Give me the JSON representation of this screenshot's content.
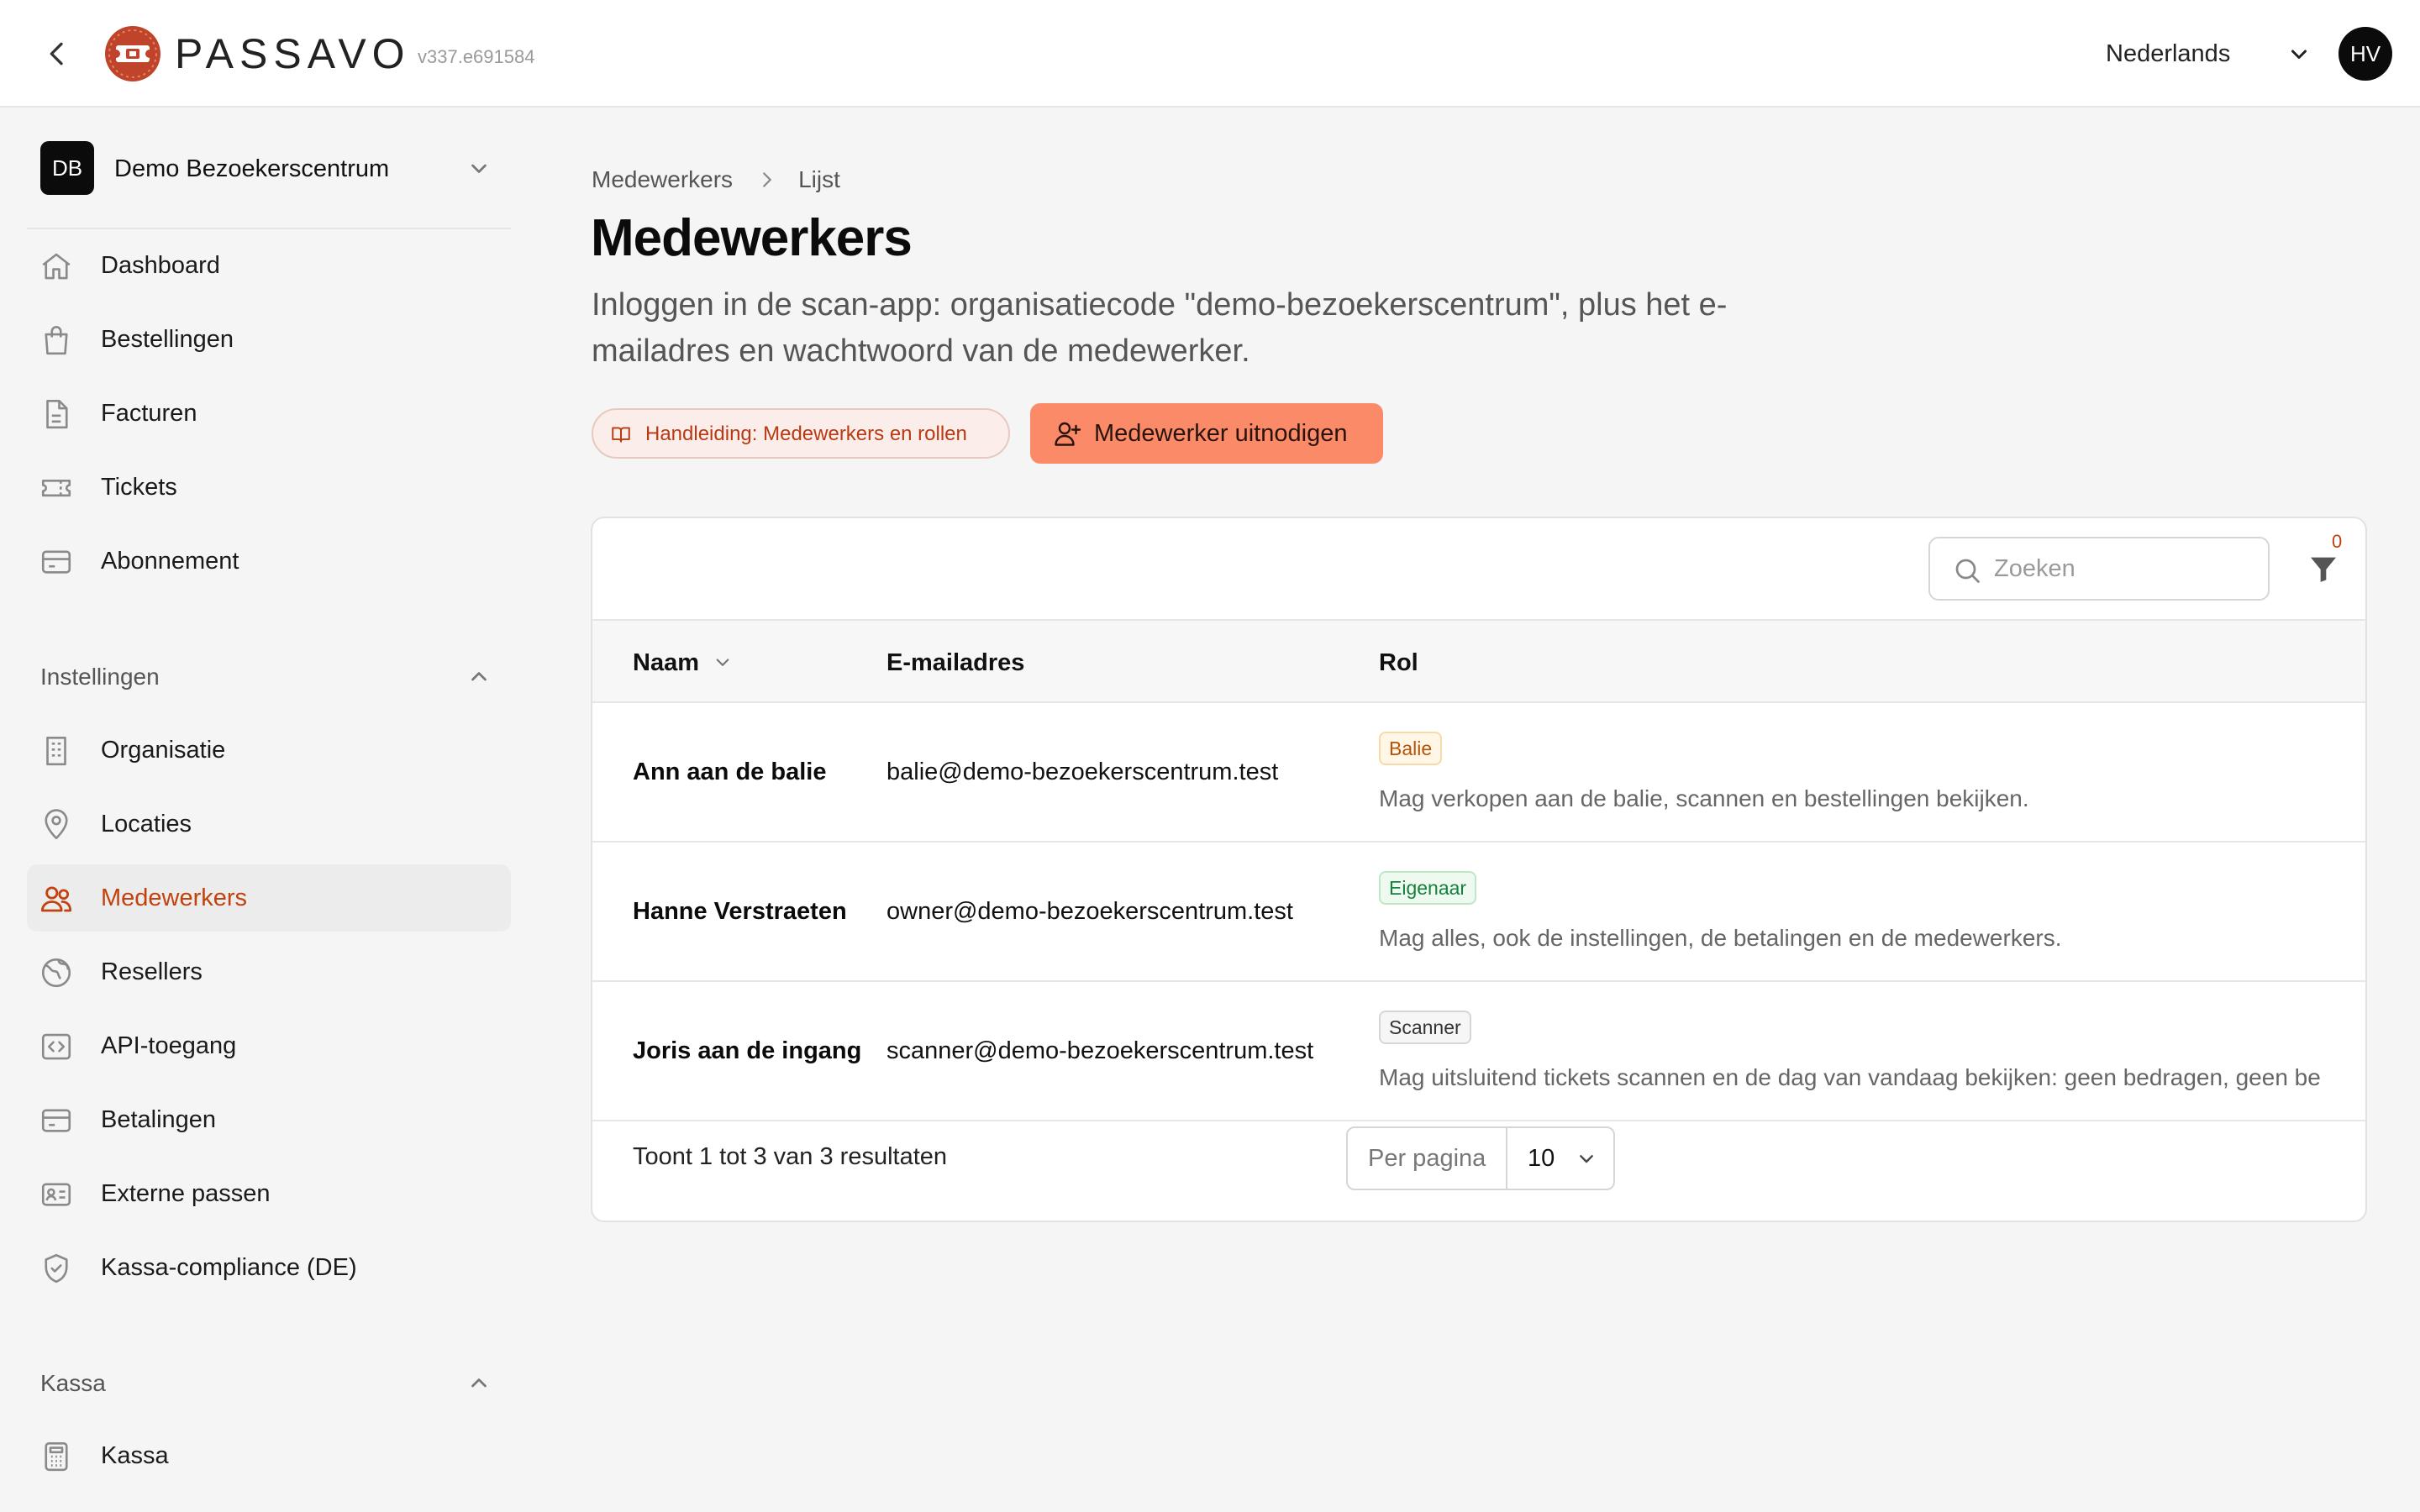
{
  "header": {
    "brand": "PASSAVO",
    "version": "v337.e691584",
    "language": "Nederlands",
    "avatar_initials": "HV"
  },
  "sidebar": {
    "org": {
      "initials": "DB",
      "name": "Demo Bezoekerscentrum"
    },
    "main_items": [
      {
        "label": "Dashboard",
        "icon": "home-icon"
      },
      {
        "label": "Bestellingen",
        "icon": "shopping-bag-icon"
      },
      {
        "label": "Facturen",
        "icon": "document-icon"
      },
      {
        "label": "Tickets",
        "icon": "ticket-icon"
      },
      {
        "label": "Abonnement",
        "icon": "credit-card-icon"
      }
    ],
    "settings_section": {
      "label": "Instellingen"
    },
    "settings_items": [
      {
        "label": "Organisatie",
        "icon": "building-icon"
      },
      {
        "label": "Locaties",
        "icon": "map-pin-icon"
      },
      {
        "label": "Medewerkers",
        "icon": "users-icon",
        "active": true
      },
      {
        "label": "Resellers",
        "icon": "globe-icon"
      },
      {
        "label": "API-toegang",
        "icon": "code-icon"
      },
      {
        "label": "Betalingen",
        "icon": "credit-card-icon"
      },
      {
        "label": "Externe passen",
        "icon": "id-card-icon"
      },
      {
        "label": "Kassa-compliance (DE)",
        "icon": "shield-check-icon"
      }
    ],
    "kassa_section": {
      "label": "Kassa"
    },
    "kassa_items": [
      {
        "label": "Kassa",
        "icon": "calculator-icon"
      }
    ]
  },
  "breadcrumb": [
    "Medewerkers",
    "Lijst"
  ],
  "page": {
    "title": "Medewerkers",
    "description": "Inloggen in de scan-app: organisatiecode \"demo-bezoekerscentrum\", plus het e-mailadres en wachtwoord van de medewerker.",
    "manual_button": "Handleiding: Medewerkers en rollen",
    "invite_button": "Medewerker uitnodigen"
  },
  "table": {
    "search_placeholder": "Zoeken",
    "filter_count": "0",
    "columns": {
      "name": "Naam",
      "email": "E-mailadres",
      "role": "Rol"
    },
    "rows": [
      {
        "name": "Ann aan de balie",
        "email": "balie@demo-bezoekerscentrum.test",
        "role": "Balie",
        "role_description": "Mag verkopen aan de balie, scannen en bestellingen bekijken."
      },
      {
        "name": "Hanne Verstraeten",
        "email": "owner@demo-bezoekerscentrum.test",
        "role": "Eigenaar",
        "role_description": "Mag alles, ook de instellingen, de betalingen en de medewerkers."
      },
      {
        "name": "Joris aan de ingang",
        "email": "scanner@demo-bezoekerscentrum.test",
        "role": "Scanner",
        "role_description": "Mag uitsluitend tickets scannen en de dag van vandaag bekijken: geen bedragen, geen be"
      }
    ],
    "results_text": "Toont 1 tot 3 van 3 resultaten",
    "per_page_label": "Per pagina",
    "per_page_value": "10"
  },
  "colors": {
    "accent": "#c2410c",
    "brand_logo": "#c0442a",
    "invite_button": "#fa8a68",
    "manual_button_bg": "#fbeeea"
  }
}
